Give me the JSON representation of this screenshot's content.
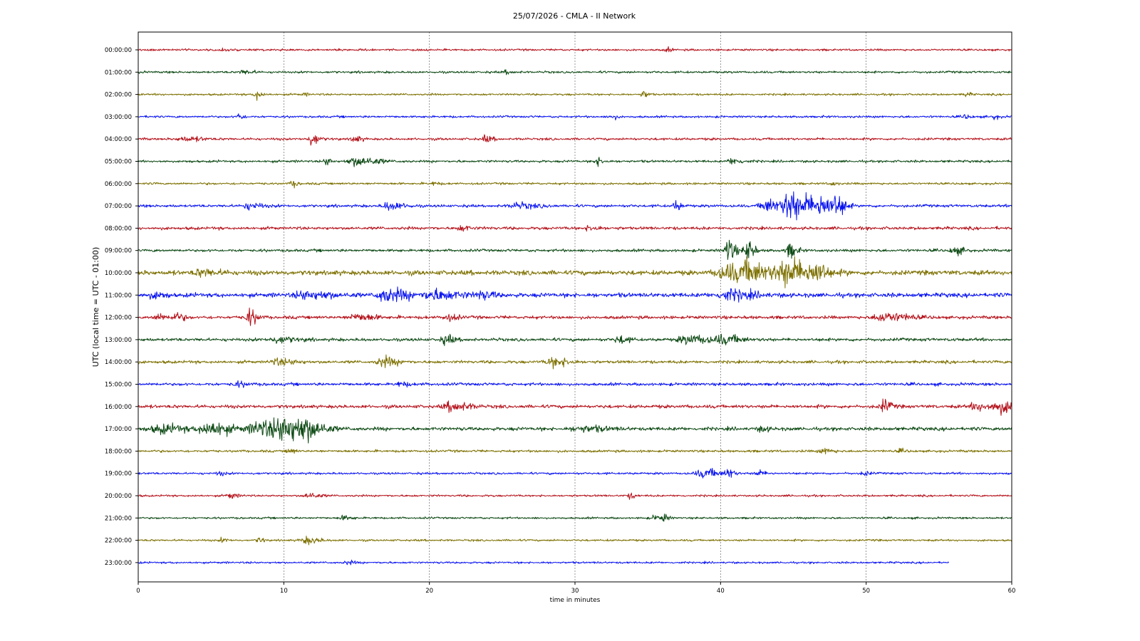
{
  "chart_data": {
    "type": "line",
    "title": "25/07/2026 - CMLA - II Network",
    "xlabel": "time in minutes",
    "ylabel": "UTC (local time = UTC - 01:00)",
    "xlim": [
      0,
      60
    ],
    "x_ticks": [
      "0",
      "10",
      "20",
      "30",
      "40",
      "50",
      "60"
    ],
    "grid": "vertical-dashed",
    "legend": "none",
    "color_cycle": [
      "#b5121b",
      "#0d4a14",
      "#7d7000",
      "#0a14f0"
    ],
    "rows": [
      {
        "label": "00:00:00",
        "noise": 0.5,
        "end_minute": 60,
        "events": [
          {
            "t": 5.7,
            "amp": 1.2,
            "dur": 0.3
          },
          {
            "t": 36.3,
            "amp": 1.0,
            "dur": 0.3
          }
        ]
      },
      {
        "label": "01:00:00",
        "noise": 0.55,
        "end_minute": 60,
        "events": [
          {
            "t": 7.2,
            "amp": 1.0,
            "dur": 0.6
          },
          {
            "t": 25.2,
            "amp": 0.9,
            "dur": 0.4
          }
        ]
      },
      {
        "label": "02:00:00",
        "noise": 0.5,
        "end_minute": 60,
        "events": [
          {
            "t": 8.1,
            "amp": 2.8,
            "dur": 0.3
          },
          {
            "t": 11.4,
            "amp": 1.0,
            "dur": 0.2
          },
          {
            "t": 34.7,
            "amp": 1.8,
            "dur": 0.3
          },
          {
            "t": 56.8,
            "amp": 1.0,
            "dur": 0.3
          }
        ]
      },
      {
        "label": "03:00:00",
        "noise": 0.55,
        "end_minute": 60,
        "events": [
          {
            "t": 6.9,
            "amp": 1.6,
            "dur": 0.3
          },
          {
            "t": 32.5,
            "amp": 1.0,
            "dur": 0.4
          },
          {
            "t": 56.8,
            "amp": 1.0,
            "dur": 0.4
          },
          {
            "t": 58.8,
            "amp": 1.2,
            "dur": 0.3
          }
        ]
      },
      {
        "label": "04:00:00",
        "noise": 0.6,
        "end_minute": 60,
        "events": [
          {
            "t": 3.2,
            "amp": 1.2,
            "dur": 1.0
          },
          {
            "t": 11.9,
            "amp": 3.5,
            "dur": 0.4
          },
          {
            "t": 14.8,
            "amp": 1.8,
            "dur": 0.4
          },
          {
            "t": 23.8,
            "amp": 1.8,
            "dur": 0.4
          }
        ]
      },
      {
        "label": "05:00:00",
        "noise": 0.6,
        "end_minute": 60,
        "events": [
          {
            "t": 12.9,
            "amp": 2.0,
            "dur": 0.3
          },
          {
            "t": 15.0,
            "amp": 2.4,
            "dur": 1.2
          },
          {
            "t": 31.5,
            "amp": 2.0,
            "dur": 0.4
          },
          {
            "t": 40.8,
            "amp": 1.6,
            "dur": 0.6
          }
        ]
      },
      {
        "label": "06:00:00",
        "noise": 0.55,
        "end_minute": 60,
        "events": [
          {
            "t": 10.6,
            "amp": 1.6,
            "dur": 0.3
          },
          {
            "t": 20.3,
            "amp": 1.0,
            "dur": 0.3
          },
          {
            "t": 47.7,
            "amp": 1.0,
            "dur": 0.3
          }
        ]
      },
      {
        "label": "07:00:00",
        "noise": 0.7,
        "end_minute": 60,
        "events": [
          {
            "t": 7.5,
            "amp": 1.6,
            "dur": 0.8
          },
          {
            "t": 17.2,
            "amp": 2.2,
            "dur": 0.8
          },
          {
            "t": 26.0,
            "amp": 1.4,
            "dur": 1.2
          },
          {
            "t": 36.9,
            "amp": 2.8,
            "dur": 0.3
          },
          {
            "t": 43.2,
            "amp": 3.5,
            "dur": 0.9
          },
          {
            "t": 44.7,
            "amp": 9.0,
            "dur": 0.7
          },
          {
            "t": 46.0,
            "amp": 4.5,
            "dur": 0.6
          },
          {
            "t": 47.0,
            "amp": 5.5,
            "dur": 0.7
          },
          {
            "t": 48.0,
            "amp": 5.0,
            "dur": 0.5
          }
        ]
      },
      {
        "label": "08:00:00",
        "noise": 0.75,
        "end_minute": 60,
        "events": [
          {
            "t": 22.2,
            "amp": 1.4,
            "dur": 0.5
          },
          {
            "t": 31.0,
            "amp": 1.2,
            "dur": 0.6
          }
        ]
      },
      {
        "label": "09:00:00",
        "noise": 0.7,
        "end_minute": 60,
        "events": [
          {
            "t": 40.5,
            "amp": 6.5,
            "dur": 0.4
          },
          {
            "t": 41.8,
            "amp": 6.0,
            "dur": 0.4
          },
          {
            "t": 44.7,
            "amp": 4.0,
            "dur": 0.4
          },
          {
            "t": 56.0,
            "amp": 1.8,
            "dur": 0.6
          }
        ]
      },
      {
        "label": "10:00:00",
        "noise": 1.2,
        "end_minute": 60,
        "events": [
          {
            "t": 4.3,
            "amp": 1.6,
            "dur": 1.0
          },
          {
            "t": 40.5,
            "amp": 4.5,
            "dur": 1.4
          },
          {
            "t": 42.0,
            "amp": 4.0,
            "dur": 1.0
          },
          {
            "t": 44.5,
            "amp": 7.0,
            "dur": 1.6
          },
          {
            "t": 46.5,
            "amp": 3.2,
            "dur": 0.6
          }
        ]
      },
      {
        "label": "11:00:00",
        "noise": 1.1,
        "end_minute": 60,
        "events": [
          {
            "t": 1.0,
            "amp": 1.6,
            "dur": 0.6
          },
          {
            "t": 11.5,
            "amp": 2.0,
            "dur": 1.5
          },
          {
            "t": 17.0,
            "amp": 3.5,
            "dur": 1.2
          },
          {
            "t": 20.3,
            "amp": 2.6,
            "dur": 1.4
          },
          {
            "t": 23.5,
            "amp": 1.8,
            "dur": 0.8
          },
          {
            "t": 40.5,
            "amp": 2.6,
            "dur": 1.4
          }
        ]
      },
      {
        "label": "12:00:00",
        "noise": 0.8,
        "end_minute": 60,
        "events": [
          {
            "t": 1.3,
            "amp": 1.6,
            "dur": 0.5
          },
          {
            "t": 2.5,
            "amp": 2.2,
            "dur": 0.5
          },
          {
            "t": 7.6,
            "amp": 4.8,
            "dur": 0.4
          },
          {
            "t": 15.0,
            "amp": 1.8,
            "dur": 1.0
          },
          {
            "t": 21.2,
            "amp": 1.6,
            "dur": 0.6
          },
          {
            "t": 51.2,
            "amp": 2.4,
            "dur": 1.4
          }
        ]
      },
      {
        "label": "13:00:00",
        "noise": 0.8,
        "end_minute": 60,
        "events": [
          {
            "t": 9.5,
            "amp": 1.6,
            "dur": 1.0
          },
          {
            "t": 21.1,
            "amp": 2.4,
            "dur": 0.5
          },
          {
            "t": 33.0,
            "amp": 2.2,
            "dur": 0.5
          },
          {
            "t": 37.8,
            "amp": 2.2,
            "dur": 1.4
          },
          {
            "t": 40.2,
            "amp": 2.0,
            "dur": 1.0
          }
        ]
      },
      {
        "label": "14:00:00",
        "noise": 0.75,
        "end_minute": 60,
        "events": [
          {
            "t": 9.6,
            "amp": 1.6,
            "dur": 1.0
          },
          {
            "t": 16.8,
            "amp": 2.6,
            "dur": 0.8
          },
          {
            "t": 28.5,
            "amp": 2.4,
            "dur": 0.9
          }
        ]
      },
      {
        "label": "15:00:00",
        "noise": 0.75,
        "end_minute": 60,
        "events": [
          {
            "t": 6.8,
            "amp": 1.2,
            "dur": 0.6
          },
          {
            "t": 18.0,
            "amp": 1.0,
            "dur": 0.6
          }
        ]
      },
      {
        "label": "16:00:00",
        "noise": 0.85,
        "end_minute": 60,
        "events": [
          {
            "t": 21.5,
            "amp": 2.4,
            "dur": 1.0
          },
          {
            "t": 51.2,
            "amp": 3.5,
            "dur": 0.4
          },
          {
            "t": 57.5,
            "amp": 2.0,
            "dur": 0.8
          },
          {
            "t": 59.2,
            "amp": 3.2,
            "dur": 1.0
          }
        ]
      },
      {
        "label": "17:00:00",
        "noise": 0.9,
        "end_minute": 60,
        "events": [
          {
            "t": 1.5,
            "amp": 2.2,
            "dur": 1.4
          },
          {
            "t": 4.6,
            "amp": 3.2,
            "dur": 0.8
          },
          {
            "t": 5.5,
            "amp": 2.0,
            "dur": 1.0
          },
          {
            "t": 8.4,
            "amp": 4.0,
            "dur": 1.6
          },
          {
            "t": 10.2,
            "amp": 5.5,
            "dur": 1.6
          },
          {
            "t": 11.5,
            "amp": 2.6,
            "dur": 0.8
          },
          {
            "t": 30.5,
            "amp": 1.4,
            "dur": 1.4
          },
          {
            "t": 42.8,
            "amp": 1.4,
            "dur": 0.4
          }
        ]
      },
      {
        "label": "18:00:00",
        "noise": 0.6,
        "end_minute": 60,
        "events": [
          {
            "t": 10.4,
            "amp": 1.6,
            "dur": 0.3
          },
          {
            "t": 47.0,
            "amp": 1.4,
            "dur": 0.6
          },
          {
            "t": 52.3,
            "amp": 1.0,
            "dur": 0.3
          }
        ]
      },
      {
        "label": "19:00:00",
        "noise": 0.55,
        "end_minute": 60,
        "events": [
          {
            "t": 5.5,
            "amp": 1.2,
            "dur": 0.3
          },
          {
            "t": 38.8,
            "amp": 2.2,
            "dur": 1.0
          },
          {
            "t": 40.5,
            "amp": 2.8,
            "dur": 0.3
          },
          {
            "t": 42.5,
            "amp": 1.6,
            "dur": 0.4
          },
          {
            "t": 49.8,
            "amp": 1.4,
            "dur": 0.3
          }
        ]
      },
      {
        "label": "20:00:00",
        "noise": 0.5,
        "end_minute": 60,
        "events": [
          {
            "t": 6.3,
            "amp": 1.6,
            "dur": 0.4
          },
          {
            "t": 11.7,
            "amp": 1.6,
            "dur": 0.6
          },
          {
            "t": 33.8,
            "amp": 1.6,
            "dur": 0.3
          }
        ]
      },
      {
        "label": "21:00:00",
        "noise": 0.5,
        "end_minute": 60,
        "events": [
          {
            "t": 14.0,
            "amp": 1.0,
            "dur": 0.6
          },
          {
            "t": 35.5,
            "amp": 1.2,
            "dur": 0.6
          },
          {
            "t": 36.1,
            "amp": 1.6,
            "dur": 0.2
          }
        ]
      },
      {
        "label": "22:00:00",
        "noise": 0.5,
        "end_minute": 60,
        "events": [
          {
            "t": 5.7,
            "amp": 1.2,
            "dur": 0.3
          },
          {
            "t": 8.3,
            "amp": 1.4,
            "dur": 0.3
          },
          {
            "t": 11.5,
            "amp": 1.8,
            "dur": 0.8
          }
        ]
      },
      {
        "label": "23:00:00",
        "noise": 0.5,
        "end_minute": 55.7,
        "events": [
          {
            "t": 14.3,
            "amp": 1.0,
            "dur": 0.4
          }
        ]
      }
    ]
  }
}
